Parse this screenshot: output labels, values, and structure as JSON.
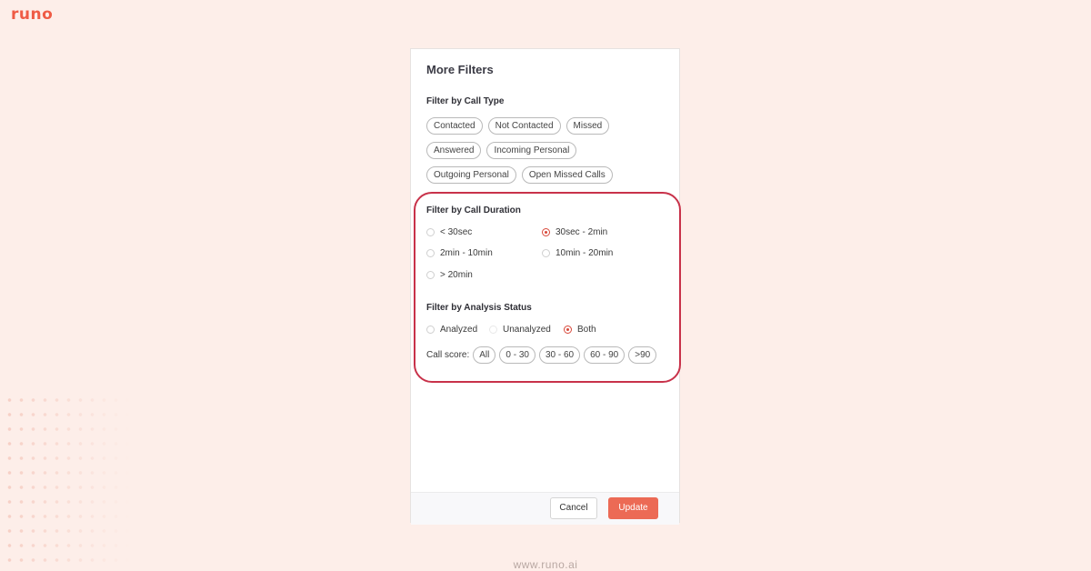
{
  "brand": {
    "logo_text": "runo",
    "footer_url": "www.runo.ai",
    "accent_color": "#ef5b45"
  },
  "panel": {
    "title": "More Filters",
    "call_type": {
      "title": "Filter by Call Type",
      "chips": [
        "Contacted",
        "Not Contacted",
        "Missed",
        "Answered",
        "Incoming Personal",
        "Outgoing Personal",
        "Open Missed Calls"
      ]
    },
    "call_duration": {
      "title": "Filter by Call Duration",
      "options": [
        "< 30sec",
        "30sec - 2min",
        "2min - 10min",
        "10min - 20min",
        "> 20min"
      ],
      "selected": "30sec - 2min"
    },
    "analysis_status": {
      "title": "Filter by Analysis Status",
      "options": [
        "Analyzed",
        "Unanalyzed",
        "Both"
      ],
      "selected": "Both"
    },
    "call_score": {
      "label": "Call score:",
      "chips": [
        "All",
        "0 - 30",
        "30 - 60",
        "60 - 90",
        ">90"
      ]
    },
    "footer": {
      "cancel_label": "Cancel",
      "update_label": "Update"
    }
  },
  "colors": {
    "highlight_border": "#c8324a",
    "radio_selected": "#d8483a",
    "update_button": "#ec6a55"
  }
}
